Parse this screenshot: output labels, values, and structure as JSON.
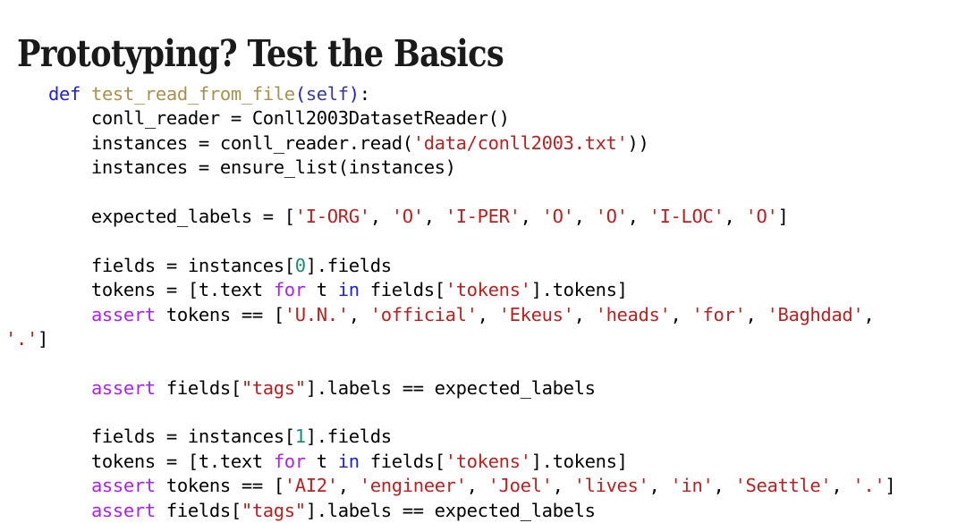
{
  "slide": {
    "title": "Prototyping? Test the Basics",
    "background_color": "#ffffff"
  },
  "palette": {
    "keyword_blue": "#2020dd",
    "keyword_magenta": "#aa22ff",
    "function_name": "#a89050",
    "self_blue": "#3838a8",
    "string_red": "#ba2121",
    "number_teal": "#1c8c6e",
    "plain_black": "#000000",
    "title_black": "#1a1a1a"
  },
  "code": {
    "language": "python",
    "lines": [
      {
        "id": "line-1",
        "tokens": [
          {
            "t": "    ",
            "c": "p"
          },
          {
            "t": "def",
            "c": "k"
          },
          {
            "t": " ",
            "c": "p"
          },
          {
            "t": "test_read_from_file",
            "c": "fn"
          },
          {
            "t": "(",
            "c": "k"
          },
          {
            "t": "self",
            "c": "self"
          },
          {
            "t": ")",
            "c": "k"
          },
          {
            "t": ":",
            "c": "p"
          }
        ]
      },
      {
        "id": "line-2",
        "tokens": [
          {
            "t": "        conll_reader = Conll2003DatasetReader()",
            "c": "p"
          }
        ]
      },
      {
        "id": "line-3",
        "tokens": [
          {
            "t": "        instances = conll_reader.read(",
            "c": "p"
          },
          {
            "t": "'data/conll2003.txt'",
            "c": "str"
          },
          {
            "t": "))",
            "c": "p"
          }
        ]
      },
      {
        "id": "line-4",
        "tokens": [
          {
            "t": "        instances = ensure_list(instances)",
            "c": "p"
          }
        ]
      },
      {
        "id": "line-5",
        "blank": true,
        "tokens": []
      },
      {
        "id": "line-6",
        "tokens": [
          {
            "t": "        expected_labels = [",
            "c": "p"
          },
          {
            "t": "'I-ORG'",
            "c": "str"
          },
          {
            "t": ", ",
            "c": "p"
          },
          {
            "t": "'O'",
            "c": "str"
          },
          {
            "t": ", ",
            "c": "p"
          },
          {
            "t": "'I-PER'",
            "c": "str"
          },
          {
            "t": ", ",
            "c": "p"
          },
          {
            "t": "'O'",
            "c": "str"
          },
          {
            "t": ", ",
            "c": "p"
          },
          {
            "t": "'O'",
            "c": "str"
          },
          {
            "t": ", ",
            "c": "p"
          },
          {
            "t": "'I-LOC'",
            "c": "str"
          },
          {
            "t": ", ",
            "c": "p"
          },
          {
            "t": "'O'",
            "c": "str"
          },
          {
            "t": "]",
            "c": "p"
          }
        ]
      },
      {
        "id": "line-7",
        "blank": true,
        "tokens": []
      },
      {
        "id": "line-8",
        "tokens": [
          {
            "t": "        fields = instances[",
            "c": "p"
          },
          {
            "t": "0",
            "c": "num"
          },
          {
            "t": "].fields",
            "c": "p"
          }
        ]
      },
      {
        "id": "line-9",
        "tokens": [
          {
            "t": "        tokens = [t.text ",
            "c": "p"
          },
          {
            "t": "for",
            "c": "kw"
          },
          {
            "t": " t ",
            "c": "p"
          },
          {
            "t": "in",
            "c": "k"
          },
          {
            "t": " fields[",
            "c": "p"
          },
          {
            "t": "'tokens'",
            "c": "str"
          },
          {
            "t": "].tokens]",
            "c": "p"
          }
        ]
      },
      {
        "id": "line-10",
        "wrapped": true,
        "tokens": [
          {
            "t": "        ",
            "c": "p"
          },
          {
            "t": "assert",
            "c": "kw"
          },
          {
            "t": " tokens == [",
            "c": "p"
          },
          {
            "t": "'U.N.'",
            "c": "str"
          },
          {
            "t": ", ",
            "c": "p"
          },
          {
            "t": "'official'",
            "c": "str"
          },
          {
            "t": ", ",
            "c": "p"
          },
          {
            "t": "'Ekeus'",
            "c": "str"
          },
          {
            "t": ", ",
            "c": "p"
          },
          {
            "t": "'heads'",
            "c": "str"
          },
          {
            "t": ", ",
            "c": "p"
          },
          {
            "t": "'for'",
            "c": "str"
          },
          {
            "t": ", ",
            "c": "p"
          },
          {
            "t": "'Baghdad'",
            "c": "str"
          },
          {
            "t": ", ",
            "c": "p"
          }
        ]
      },
      {
        "id": "line-10-cont",
        "continuation": true,
        "tokens": [
          {
            "t": "'.'",
            "c": "str"
          },
          {
            "t": "]",
            "c": "p"
          }
        ]
      },
      {
        "id": "line-11",
        "blank": true,
        "tokens": []
      },
      {
        "id": "line-12",
        "tokens": [
          {
            "t": "        ",
            "c": "p"
          },
          {
            "t": "assert",
            "c": "kw"
          },
          {
            "t": " fields[",
            "c": "p"
          },
          {
            "t": "\"tags\"",
            "c": "str"
          },
          {
            "t": "].labels == expected_labels",
            "c": "p"
          }
        ]
      },
      {
        "id": "line-13",
        "blank": true,
        "tokens": []
      },
      {
        "id": "line-14",
        "tokens": [
          {
            "t": "        fields = instances[",
            "c": "p"
          },
          {
            "t": "1",
            "c": "num"
          },
          {
            "t": "].fields",
            "c": "p"
          }
        ]
      },
      {
        "id": "line-15",
        "tokens": [
          {
            "t": "        tokens = [t.text ",
            "c": "p"
          },
          {
            "t": "for",
            "c": "kw"
          },
          {
            "t": " t ",
            "c": "p"
          },
          {
            "t": "in",
            "c": "k"
          },
          {
            "t": " fields[",
            "c": "p"
          },
          {
            "t": "'tokens'",
            "c": "str"
          },
          {
            "t": "].tokens]",
            "c": "p"
          }
        ]
      },
      {
        "id": "line-16",
        "tokens": [
          {
            "t": "        ",
            "c": "p"
          },
          {
            "t": "assert",
            "c": "kw"
          },
          {
            "t": " tokens == [",
            "c": "p"
          },
          {
            "t": "'AI2'",
            "c": "str"
          },
          {
            "t": ", ",
            "c": "p"
          },
          {
            "t": "'engineer'",
            "c": "str"
          },
          {
            "t": ", ",
            "c": "p"
          },
          {
            "t": "'Joel'",
            "c": "str"
          },
          {
            "t": ", ",
            "c": "p"
          },
          {
            "t": "'lives'",
            "c": "str"
          },
          {
            "t": ", ",
            "c": "p"
          },
          {
            "t": "'in'",
            "c": "str"
          },
          {
            "t": ", ",
            "c": "p"
          },
          {
            "t": "'Seattle'",
            "c": "str"
          },
          {
            "t": ", ",
            "c": "p"
          },
          {
            "t": "'.'",
            "c": "str"
          },
          {
            "t": "]",
            "c": "p"
          }
        ]
      },
      {
        "id": "line-17",
        "tokens": [
          {
            "t": "        ",
            "c": "p"
          },
          {
            "t": "assert",
            "c": "kw"
          },
          {
            "t": " fields[",
            "c": "p"
          },
          {
            "t": "\"tags\"",
            "c": "str"
          },
          {
            "t": "].labels == expected_labels",
            "c": "p"
          }
        ]
      }
    ]
  }
}
